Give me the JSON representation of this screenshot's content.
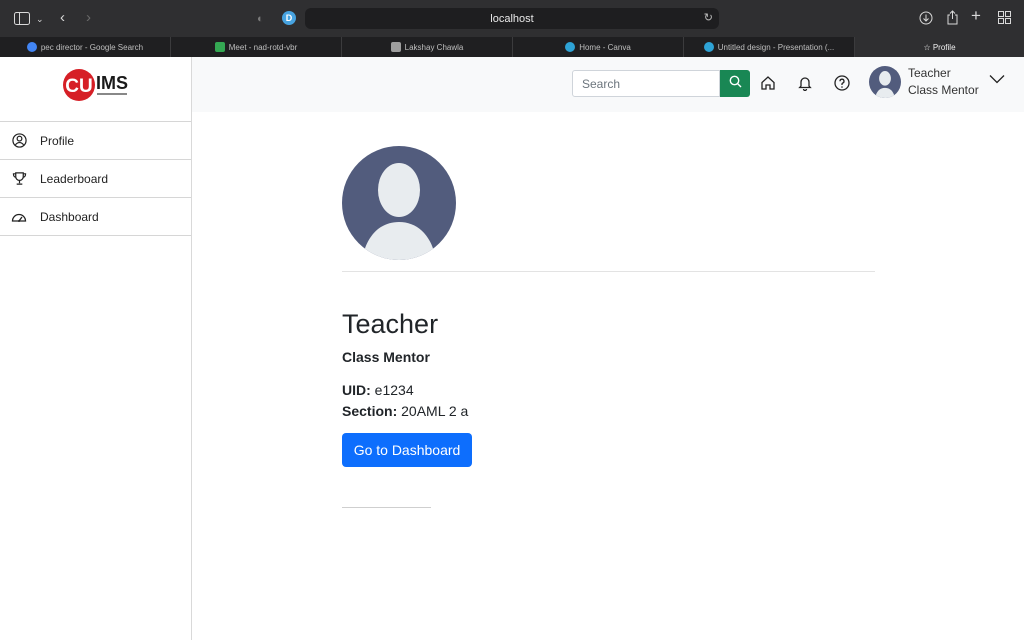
{
  "browser": {
    "url": "localhost",
    "profile_badge": "D",
    "tabs": [
      {
        "label": "pec director - Google Search",
        "color": "#4285f4"
      },
      {
        "label": "Meet - nad-rotd-vbr",
        "color": "#34a853"
      },
      {
        "label": "Lakshay Chawla",
        "color": "#9e9e9e"
      },
      {
        "label": "Home - Canva",
        "color": "#2ea3d6"
      },
      {
        "label": "Untitled design - Presentation (...",
        "color": "#2ea3d6"
      },
      {
        "label": "☆ Profile",
        "color": ""
      }
    ]
  },
  "app": {
    "logo_letters": "CU",
    "logo_text": "IMS",
    "sidebar": [
      {
        "label": "Profile",
        "icon": "user-circle-icon"
      },
      {
        "label": "Leaderboard",
        "icon": "trophy-icon"
      },
      {
        "label": "Dashboard",
        "icon": "speedometer-icon"
      }
    ],
    "header": {
      "search_placeholder": "Search",
      "user_name": "Teacher",
      "user_role": "Class Mentor"
    },
    "profile": {
      "name": "Teacher",
      "role": "Class Mentor",
      "uid_label": "UID:",
      "uid_value": " e1234",
      "section_label": "Section:",
      "section_value": " 20AML 2 a",
      "dashboard_button": "Go to Dashboard"
    },
    "colors": {
      "search_button": "#198754",
      "primary_button": "#0d6efd",
      "avatar_bg": "#525c7d"
    }
  }
}
